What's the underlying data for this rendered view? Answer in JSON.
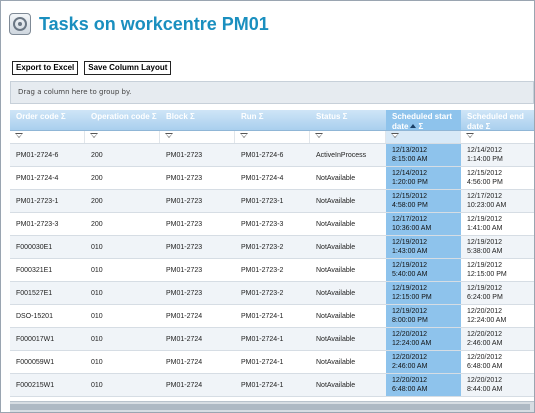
{
  "header": {
    "title": "Tasks on workcentre PM01",
    "logo_icon": "workcentre-logo-icon"
  },
  "toolbar": {
    "export_label": "Export to Excel",
    "save_layout_label": "Save Column Layout"
  },
  "group_panel": {
    "hint": "Drag a column here to group by."
  },
  "columns": [
    {
      "label": "Order code Σ",
      "sorted": false
    },
    {
      "label": "Operation code Σ",
      "sorted": false
    },
    {
      "label": "Block Σ",
      "sorted": false
    },
    {
      "label": "Run Σ",
      "sorted": false
    },
    {
      "label": "Status Σ",
      "sorted": false
    },
    {
      "label": "Scheduled start date",
      "label_suffix": "Σ",
      "sorted": true,
      "sort_direction": "ascending"
    },
    {
      "label": "Scheduled end date Σ",
      "sorted": false
    }
  ],
  "rows": [
    [
      "PM01-2724-6",
      "200",
      "PM01-2723",
      "PM01-2724-6",
      "ActiveInProcess",
      "12/13/2012\n8:15:00 AM",
      "12/14/2012\n1:14:00 PM"
    ],
    [
      "PM01-2724-4",
      "200",
      "PM01-2723",
      "PM01-2724-4",
      "NotAvailable",
      "12/14/2012\n1:20:00 PM",
      "12/15/2012\n4:56:00 PM"
    ],
    [
      "PM01-2723-1",
      "200",
      "PM01-2723",
      "PM01-2723-1",
      "NotAvailable",
      "12/15/2012\n4:58:00 PM",
      "12/17/2012\n10:23:00 AM"
    ],
    [
      "PM01-2723-3",
      "200",
      "PM01-2723",
      "PM01-2723-3",
      "NotAvailable",
      "12/17/2012\n10:36:00 AM",
      "12/19/2012\n1:41:00 AM"
    ],
    [
      "F000030E1",
      "010",
      "PM01-2723",
      "PM01-2723-2",
      "NotAvailable",
      "12/19/2012\n1:43:00 AM",
      "12/19/2012\n5:38:00 AM"
    ],
    [
      "F000321E1",
      "010",
      "PM01-2723",
      "PM01-2723-2",
      "NotAvailable",
      "12/19/2012\n5:40:00 AM",
      "12/19/2012\n12:15:00 PM"
    ],
    [
      "F001527E1",
      "010",
      "PM01-2723",
      "PM01-2723-2",
      "NotAvailable",
      "12/19/2012\n12:15:00 PM",
      "12/19/2012\n6:24:00 PM"
    ],
    [
      "DSO-15201",
      "010",
      "PM01-2724",
      "PM01-2724-1",
      "NotAvailable",
      "12/19/2012\n8:00:00 PM",
      "12/20/2012\n12:24:00 AM"
    ],
    [
      "F000017W1",
      "010",
      "PM01-2724",
      "PM01-2724-1",
      "NotAvailable",
      "12/20/2012\n12:24:00 AM",
      "12/20/2012\n2:46:00 AM"
    ],
    [
      "F000059W1",
      "010",
      "PM01-2724",
      "PM01-2724-1",
      "NotAvailable",
      "12/20/2012\n2:46:00 AM",
      "12/20/2012\n6:48:00 AM"
    ],
    [
      "F000215W1",
      "010",
      "PM01-2724",
      "PM01-2724-1",
      "NotAvailable",
      "12/20/2012\n6:48:00 AM",
      "12/20/2012\n8:44:00 AM"
    ]
  ],
  "colors": {
    "accent": "#1a8fbf",
    "header_gradient_top": "#cfe5f7",
    "header_gradient_bottom": "#a9cfee",
    "sorted_column": "#8ec3ec"
  }
}
